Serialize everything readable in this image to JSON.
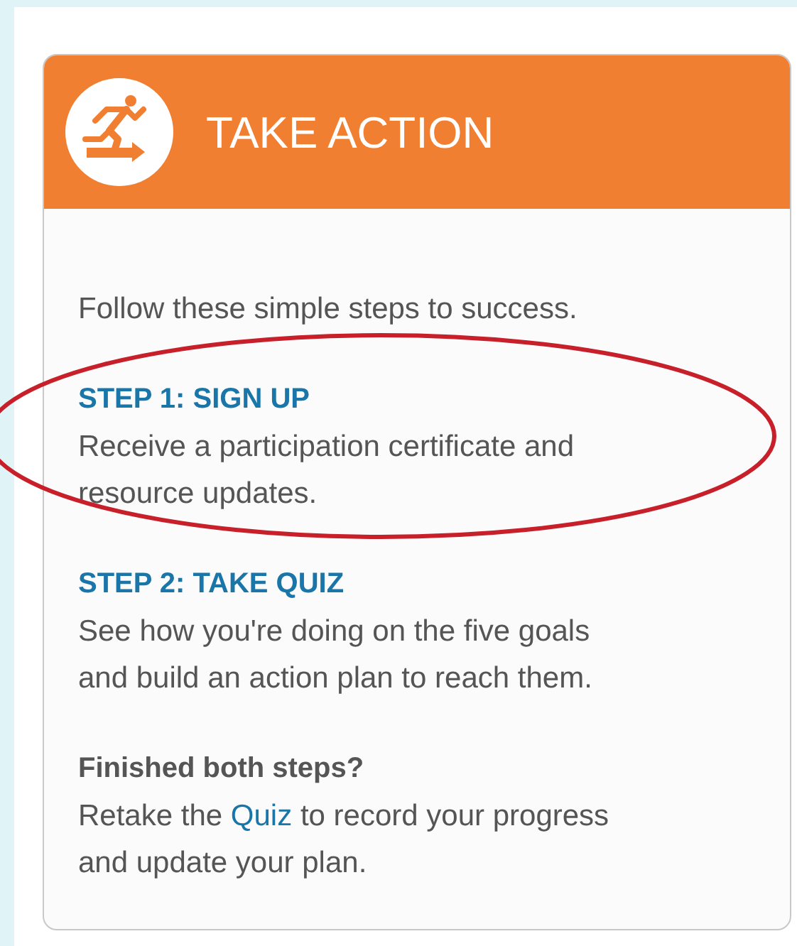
{
  "panel": {
    "title": "TAKE ACTION",
    "intro": "Follow these simple steps to success.",
    "steps": [
      {
        "heading": "STEP 1: SIGN UP",
        "text": "Receive a participation certificate and resource updates.",
        "circled": true
      },
      {
        "heading": "STEP 2: TAKE QUIZ",
        "text": "See how you're doing on the five goals and build an action plan to reach them.",
        "circled": false
      }
    ],
    "finish": {
      "heading": "Finished both steps?",
      "before": "Retake the",
      "link": "Quiz",
      "after": "to record your progress and update your plan."
    }
  }
}
